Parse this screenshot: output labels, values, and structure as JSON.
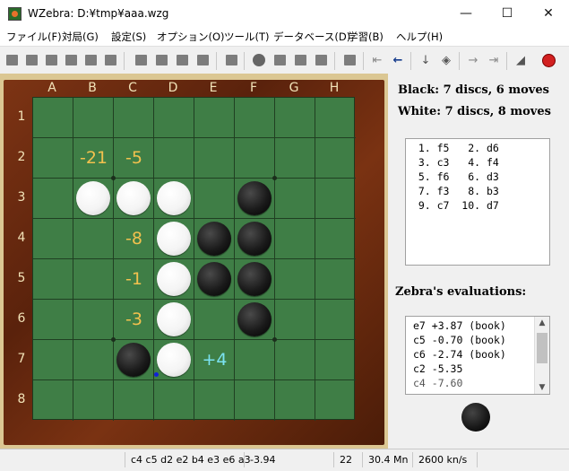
{
  "window": {
    "title": "WZebra: D:¥tmp¥aaa.wzg",
    "minimize": "—",
    "maximize": "☐",
    "close": "✕"
  },
  "menu": [
    {
      "label": "ファイル(F)"
    },
    {
      "label": "対局(G)"
    },
    {
      "label": "設定(S)"
    },
    {
      "label": "オプション(O)"
    },
    {
      "label": "ツール(T)"
    },
    {
      "label": "データベース(D)"
    },
    {
      "label": "学習(B)"
    },
    {
      "label": "ヘルプ(H)"
    }
  ],
  "board": {
    "columns": [
      "A",
      "B",
      "C",
      "D",
      "E",
      "F",
      "G",
      "H"
    ],
    "rows": [
      "1",
      "2",
      "3",
      "4",
      "5",
      "6",
      "7",
      "8"
    ],
    "white_discs": [
      "B3",
      "C3",
      "D3",
      "D4",
      "D5",
      "D6",
      "D7"
    ],
    "black_discs": [
      "F3",
      "E4",
      "F4",
      "E5",
      "F5",
      "F6",
      "C7"
    ],
    "evaluations": [
      {
        "square": "B2",
        "value": "-21",
        "color": "#f2c14e"
      },
      {
        "square": "C2",
        "value": "-5",
        "color": "#f2c14e"
      },
      {
        "square": "C4",
        "value": "-8",
        "color": "#f2c14e"
      },
      {
        "square": "C5",
        "value": "-1",
        "color": "#f2c14e"
      },
      {
        "square": "C6",
        "value": "-3",
        "color": "#f2c14e"
      },
      {
        "square": "E7",
        "value": "+4",
        "color": "#7be3f2"
      }
    ],
    "colors": {
      "felt": "#3f7e46",
      "frame": "#6b2a10",
      "label": "#f2e3b8"
    }
  },
  "score": {
    "black": "Black:   7 discs, 6 moves",
    "white": "White:   7 discs, 8 moves"
  },
  "moves": [
    "  1. f5   2. d6",
    "  3. c3   4. f4",
    "  5. f6   6. d3",
    "  7. f3   8. b3",
    "  9. c7  10. d7"
  ],
  "evaluations_title": "Zebra's evaluations:",
  "eval_list": [
    "e7 +3.87 (book)",
    "c5 -0.70 (book)",
    "c6 -2.74 (book)",
    "c2 -5.35",
    "c4 -7.60"
  ],
  "turn": "black",
  "status": {
    "line": "c4 c5 d2 e2 b4 e3 e6 a3",
    "score": "-3.94",
    "depth": "22",
    "nodes": "30.4 Mn",
    "speed": "2600 kn/s"
  },
  "toolbar_icons": [
    "new-board-icon",
    "blank-icon",
    "open-icon",
    "save-icon",
    "print-icon",
    "folder-icon",
    "analyze-icon",
    "setup-icon",
    "edit-icon",
    "flip-icon",
    "book-icon",
    "info-icon",
    "stop-icon",
    "pause-icon",
    "play-icon",
    "record-icon",
    "score-icon",
    "first-move-icon",
    "back-icon",
    "undo-icon",
    "hint-icon",
    "forward-icon",
    "last-move-icon",
    "diagonal-icon",
    "exit-icon"
  ]
}
